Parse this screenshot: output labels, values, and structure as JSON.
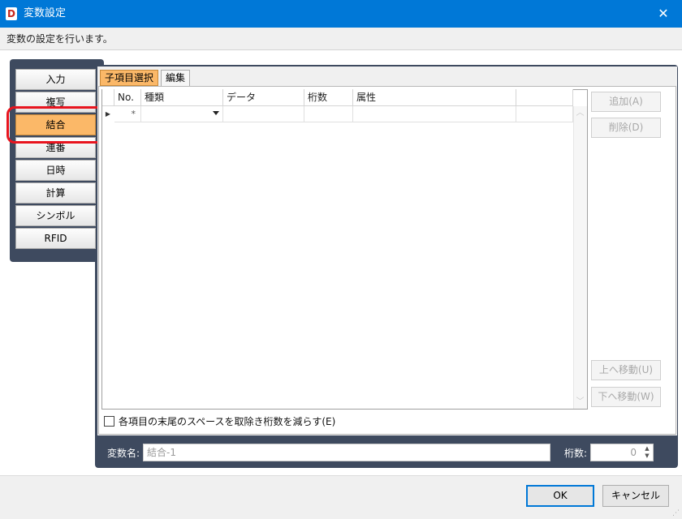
{
  "window": {
    "title": "変数設定",
    "app_icon_letter": "D",
    "close_glyph": "✕",
    "description": "変数の設定を行います。"
  },
  "sidebar": {
    "items": [
      {
        "label": "入力",
        "active": false
      },
      {
        "label": "複写",
        "active": false
      },
      {
        "label": "結合",
        "active": true
      },
      {
        "label": "連番",
        "active": false
      },
      {
        "label": "日時",
        "active": false
      },
      {
        "label": "計算",
        "active": false
      },
      {
        "label": "シンボル",
        "active": false
      },
      {
        "label": "RFID",
        "active": false
      }
    ]
  },
  "tabs": [
    {
      "label": "子項目選択",
      "active": true
    },
    {
      "label": "編集",
      "active": false
    }
  ],
  "grid": {
    "columns": [
      "No.",
      "種類",
      "データ",
      "桁数",
      "属性"
    ],
    "new_row_marker": "*",
    "row_indicator": "▶"
  },
  "actions": {
    "add": "追加(A)",
    "delete": "削除(D)",
    "move_up": "上へ移動(U)",
    "move_down": "下へ移動(W)"
  },
  "options": {
    "trim_trailing_spaces": "各項目の末尾のスペースを取除き桁数を減らす(E)",
    "trim_checked": false
  },
  "variable": {
    "name_label": "変数名:",
    "name_value": "結合-1",
    "digits_label": "桁数:",
    "digits_value": "0"
  },
  "footer": {
    "ok": "OK",
    "cancel": "キャンセル"
  },
  "colors": {
    "titlebar": "#0078d7",
    "frame": "#3e4a5f",
    "active_tab": "#fbb868",
    "highlight_ring": "#e8141e"
  }
}
